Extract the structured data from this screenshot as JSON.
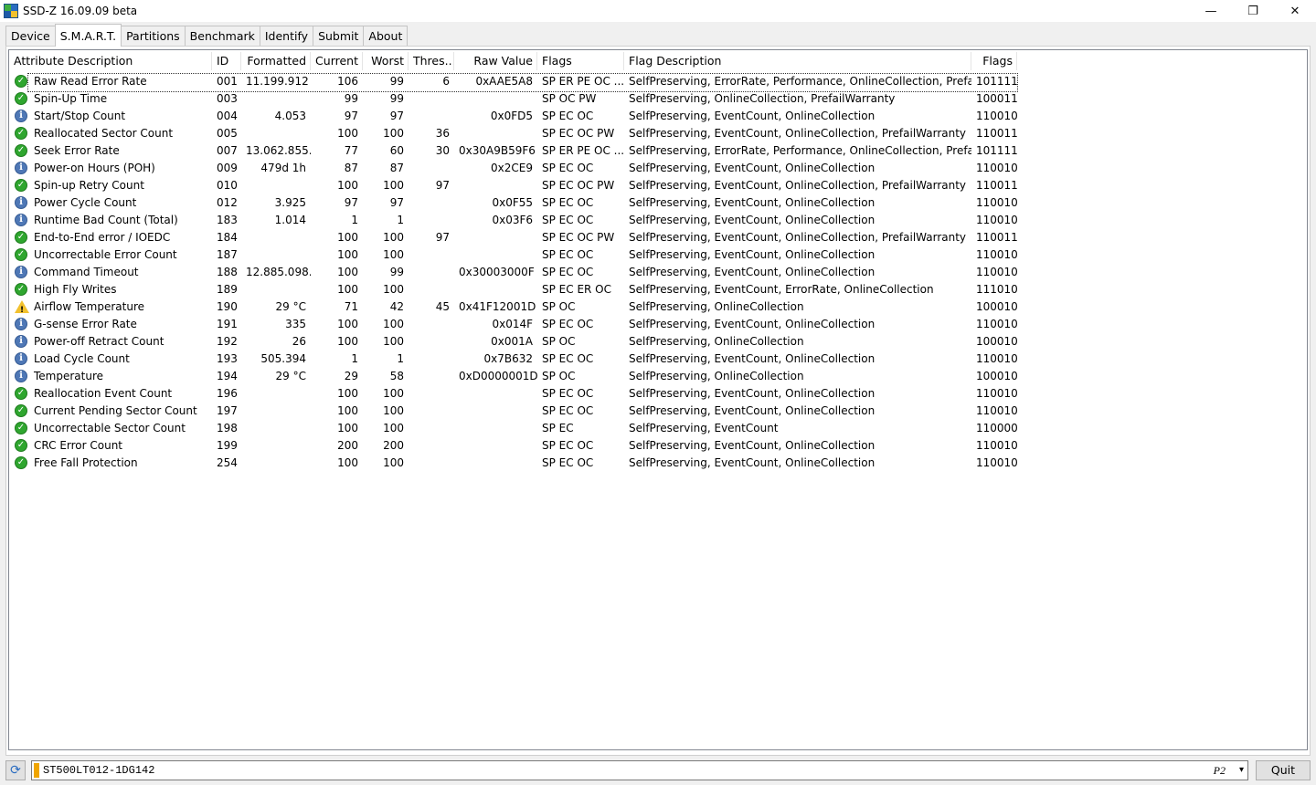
{
  "window": {
    "title": "SSD-Z 16.09.09 beta",
    "minimize_glyph": "—",
    "restore_glyph": "❐",
    "close_glyph": "✕"
  },
  "tabs": [
    "Device",
    "S.M.A.R.T.",
    "Partitions",
    "Benchmark",
    "Identify",
    "Submit",
    "About"
  ],
  "active_tab": "S.M.A.R.T.",
  "columns": {
    "attr": "Attribute Description",
    "id": "ID",
    "formatted": "Formatted",
    "current": "Current",
    "worst": "Worst",
    "threshold": "Thres...",
    "raw": "Raw Value",
    "flags": "Flags",
    "flag_desc": "Flag Description",
    "flags_bin": "Flags"
  },
  "rows": [
    {
      "status": "ok",
      "attr": "Raw Read Error Rate",
      "id": "001",
      "formatted": "11.199.912",
      "current": "106",
      "worst": "99",
      "threshold": "6",
      "raw": "0xAAE5A8",
      "flags": "SP ER PE OC ...",
      "flag_desc": "SelfPreserving, ErrorRate, Performance, OnlineCollection, PrefailWar...",
      "flags_bin": "101111"
    },
    {
      "status": "ok",
      "attr": "Spin-Up Time",
      "id": "003",
      "formatted": "",
      "current": "99",
      "worst": "99",
      "threshold": "",
      "raw": "",
      "flags": "SP OC PW",
      "flag_desc": "SelfPreserving, OnlineCollection, PrefailWarranty",
      "flags_bin": "100011"
    },
    {
      "status": "info",
      "attr": "Start/Stop Count",
      "id": "004",
      "formatted": "4.053",
      "current": "97",
      "worst": "97",
      "threshold": "",
      "raw": "0x0FD5",
      "flags": "SP EC OC",
      "flag_desc": "SelfPreserving, EventCount, OnlineCollection",
      "flags_bin": "110010"
    },
    {
      "status": "ok",
      "attr": "Reallocated Sector Count",
      "id": "005",
      "formatted": "",
      "current": "100",
      "worst": "100",
      "threshold": "36",
      "raw": "",
      "flags": "SP EC OC PW",
      "flag_desc": "SelfPreserving, EventCount, OnlineCollection, PrefailWarranty",
      "flags_bin": "110011"
    },
    {
      "status": "ok",
      "attr": "Seek Error Rate",
      "id": "007",
      "formatted": "13.062.855...",
      "current": "77",
      "worst": "60",
      "threshold": "30",
      "raw": "0x30A9B59F6",
      "flags": "SP ER PE OC ...",
      "flag_desc": "SelfPreserving, ErrorRate, Performance, OnlineCollection, PrefailWar...",
      "flags_bin": "101111"
    },
    {
      "status": "info",
      "attr": "Power-on Hours (POH)",
      "id": "009",
      "formatted": "479d 1h",
      "current": "87",
      "worst": "87",
      "threshold": "",
      "raw": "0x2CE9",
      "flags": "SP EC OC",
      "flag_desc": "SelfPreserving, EventCount, OnlineCollection",
      "flags_bin": "110010"
    },
    {
      "status": "ok",
      "attr": "Spin-up Retry Count",
      "id": "010",
      "formatted": "",
      "current": "100",
      "worst": "100",
      "threshold": "97",
      "raw": "",
      "flags": "SP EC OC PW",
      "flag_desc": "SelfPreserving, EventCount, OnlineCollection, PrefailWarranty",
      "flags_bin": "110011"
    },
    {
      "status": "info",
      "attr": "Power Cycle Count",
      "id": "012",
      "formatted": "3.925",
      "current": "97",
      "worst": "97",
      "threshold": "",
      "raw": "0x0F55",
      "flags": "SP EC OC",
      "flag_desc": "SelfPreserving, EventCount, OnlineCollection",
      "flags_bin": "110010"
    },
    {
      "status": "info",
      "attr": "Runtime Bad Count (Total)",
      "id": "183",
      "formatted": "1.014",
      "current": "1",
      "worst": "1",
      "threshold": "",
      "raw": "0x03F6",
      "flags": "SP EC OC",
      "flag_desc": "SelfPreserving, EventCount, OnlineCollection",
      "flags_bin": "110010"
    },
    {
      "status": "ok",
      "attr": "End-to-End error / IOEDC",
      "id": "184",
      "formatted": "",
      "current": "100",
      "worst": "100",
      "threshold": "97",
      "raw": "",
      "flags": "SP EC OC PW",
      "flag_desc": "SelfPreserving, EventCount, OnlineCollection, PrefailWarranty",
      "flags_bin": "110011"
    },
    {
      "status": "ok",
      "attr": "Uncorrectable Error Count",
      "id": "187",
      "formatted": "",
      "current": "100",
      "worst": "100",
      "threshold": "",
      "raw": "",
      "flags": "SP EC OC",
      "flag_desc": "SelfPreserving, EventCount, OnlineCollection",
      "flags_bin": "110010"
    },
    {
      "status": "info",
      "attr": "Command Timeout",
      "id": "188",
      "formatted": "12.885.098...",
      "current": "100",
      "worst": "99",
      "threshold": "",
      "raw": "0x30003000F",
      "flags": "SP EC OC",
      "flag_desc": "SelfPreserving, EventCount, OnlineCollection",
      "flags_bin": "110010"
    },
    {
      "status": "ok",
      "attr": "High Fly Writes",
      "id": "189",
      "formatted": "",
      "current": "100",
      "worst": "100",
      "threshold": "",
      "raw": "",
      "flags": "SP EC ER OC",
      "flag_desc": "SelfPreserving, EventCount, ErrorRate, OnlineCollection",
      "flags_bin": "111010"
    },
    {
      "status": "warn",
      "attr": "Airflow Temperature",
      "id": "190",
      "formatted": "29 °C",
      "current": "71",
      "worst": "42",
      "threshold": "45",
      "raw": "0x41F12001D",
      "flags": "SP OC",
      "flag_desc": "SelfPreserving, OnlineCollection",
      "flags_bin": "100010"
    },
    {
      "status": "info",
      "attr": "G-sense Error Rate",
      "id": "191",
      "formatted": "335",
      "current": "100",
      "worst": "100",
      "threshold": "",
      "raw": "0x014F",
      "flags": "SP EC OC",
      "flag_desc": "SelfPreserving, EventCount, OnlineCollection",
      "flags_bin": "110010"
    },
    {
      "status": "info",
      "attr": "Power-off Retract Count",
      "id": "192",
      "formatted": "26",
      "current": "100",
      "worst": "100",
      "threshold": "",
      "raw": "0x001A",
      "flags": "SP OC",
      "flag_desc": "SelfPreserving, OnlineCollection",
      "flags_bin": "100010"
    },
    {
      "status": "info",
      "attr": "Load Cycle Count",
      "id": "193",
      "formatted": "505.394",
      "current": "1",
      "worst": "1",
      "threshold": "",
      "raw": "0x7B632",
      "flags": "SP EC OC",
      "flag_desc": "SelfPreserving, EventCount, OnlineCollection",
      "flags_bin": "110010"
    },
    {
      "status": "info",
      "attr": "Temperature",
      "id": "194",
      "formatted": "29 °C",
      "current": "29",
      "worst": "58",
      "threshold": "",
      "raw": "0xD0000001D",
      "flags": "SP OC",
      "flag_desc": "SelfPreserving, OnlineCollection",
      "flags_bin": "100010"
    },
    {
      "status": "ok",
      "attr": "Reallocation Event Count",
      "id": "196",
      "formatted": "",
      "current": "100",
      "worst": "100",
      "threshold": "",
      "raw": "",
      "flags": "SP EC OC",
      "flag_desc": "SelfPreserving, EventCount, OnlineCollection",
      "flags_bin": "110010"
    },
    {
      "status": "ok",
      "attr": "Current Pending Sector Count",
      "id": "197",
      "formatted": "",
      "current": "100",
      "worst": "100",
      "threshold": "",
      "raw": "",
      "flags": "SP EC OC",
      "flag_desc": "SelfPreserving, EventCount, OnlineCollection",
      "flags_bin": "110010"
    },
    {
      "status": "ok",
      "attr": "Uncorrectable Sector Count",
      "id": "198",
      "formatted": "",
      "current": "100",
      "worst": "100",
      "threshold": "",
      "raw": "",
      "flags": "SP EC",
      "flag_desc": "SelfPreserving, EventCount",
      "flags_bin": "110000"
    },
    {
      "status": "ok",
      "attr": "CRC Error Count",
      "id": "199",
      "formatted": "",
      "current": "200",
      "worst": "200",
      "threshold": "",
      "raw": "",
      "flags": "SP EC OC",
      "flag_desc": "SelfPreserving, EventCount, OnlineCollection",
      "flags_bin": "110010"
    },
    {
      "status": "ok",
      "attr": "Free Fall Protection",
      "id": "254",
      "formatted": "",
      "current": "100",
      "worst": "100",
      "threshold": "",
      "raw": "",
      "flags": "SP EC OC",
      "flag_desc": "SelfPreserving, EventCount, OnlineCollection",
      "flags_bin": "110010"
    }
  ],
  "status_icons": {
    "ok": "check-circle-icon",
    "info": "info-circle-icon",
    "warn": "warning-triangle-icon"
  },
  "bottom": {
    "drive": "ST500LT012-1DG142",
    "port": "P2",
    "quit_label": "Quit"
  },
  "colors": {
    "ok": "#2fa62f",
    "info": "#4f78b6",
    "warn": "#f2c12e",
    "drive_marker": "#f0a500"
  }
}
